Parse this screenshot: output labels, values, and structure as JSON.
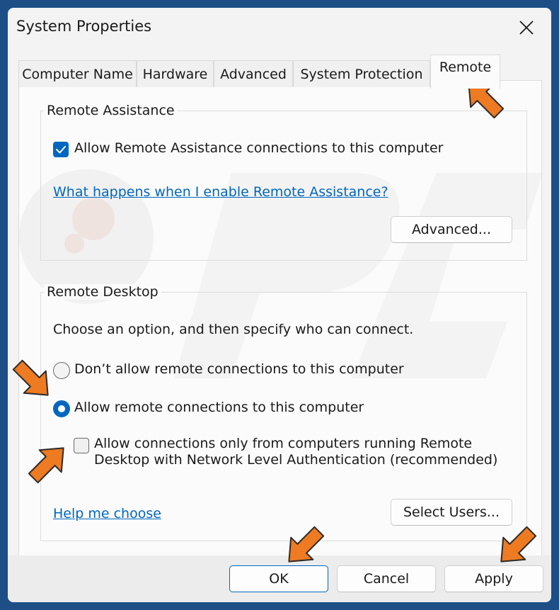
{
  "window": {
    "title": "System Properties"
  },
  "tabs": [
    {
      "label": "Computer Name"
    },
    {
      "label": "Hardware"
    },
    {
      "label": "Advanced"
    },
    {
      "label": "System Protection"
    },
    {
      "label": "Remote",
      "active": true
    }
  ],
  "remote_assistance": {
    "group_label": "Remote Assistance",
    "allow_checkbox": {
      "label": "Allow Remote Assistance connections to this computer",
      "checked": true
    },
    "help_link": "What happens when I enable Remote Assistance?",
    "advanced_button": "Advanced..."
  },
  "remote_desktop": {
    "group_label": "Remote Desktop",
    "instruction": "Choose an option, and then specify who can connect.",
    "options": [
      {
        "label": "Don’t allow remote connections to this computer",
        "selected": false
      },
      {
        "label": "Allow remote connections to this computer",
        "selected": true
      }
    ],
    "nla_checkbox": {
      "line1": "Allow connections only from computers running Remote",
      "line2": "Desktop with Network Level Authentication (recommended)",
      "checked": false
    },
    "help_link": "Help me choose",
    "select_users_button": "Select Users..."
  },
  "footer": {
    "ok_button": "OK",
    "cancel_button": "Cancel",
    "apply_button": "Apply"
  },
  "colors": {
    "accent": "#0067c0",
    "annotation_arrow": "#ee7a21",
    "background": "#1d4f86"
  },
  "icons": {
    "close": "close-icon",
    "checkmark": "checkmark-icon",
    "annotation": "orange-arrow-icon"
  }
}
